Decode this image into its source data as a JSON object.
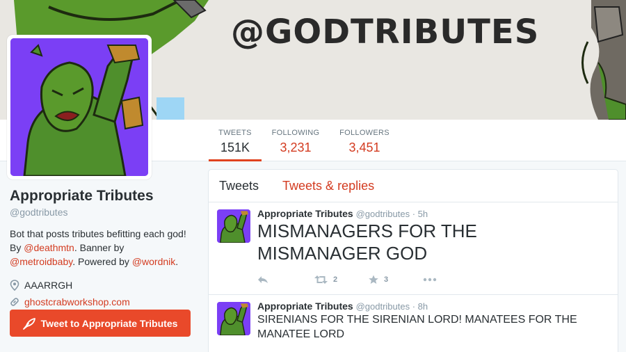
{
  "banner": {
    "handle": "@GODTRIBUTES"
  },
  "nav": {
    "tweets": {
      "label": "TWEETS",
      "value": "151K"
    },
    "following": {
      "label": "FOLLOWING",
      "value": "3,231"
    },
    "followers": {
      "label": "FOLLOWERS",
      "value": "3,451"
    }
  },
  "profile": {
    "name": "Appropriate Tributes",
    "screen_name": "@godtributes",
    "bio_line1": "Bot that posts tributes befitting each god!",
    "bio_by": "By ",
    "bio_by_link": "@deathmtn",
    "bio_banner": ". Banner by",
    "bio_banner_link": "@metroidbaby",
    "bio_powered": ". Powered by ",
    "bio_powered_link": "@wordnik",
    "bio_end": ".",
    "location": "AAARRGH",
    "website": "ghostcrabworkshop.com",
    "tweet_to_button": "Tweet to Appropriate Tributes"
  },
  "timeline": {
    "tabs": {
      "tweets": "Tweets",
      "replies": "Tweets & replies"
    },
    "tweets": [
      {
        "author": "Appropriate Tributes",
        "handle": "@godtributes",
        "sep": " · ",
        "time": "5h",
        "text": "MISMANAGERS FOR THE MISMANAGER GOD",
        "retweets": "2",
        "favorites": "3"
      },
      {
        "author": "Appropriate Tributes",
        "handle": "@godtributes",
        "sep": " · ",
        "time": "8h",
        "text": "SIRENIANS FOR THE SIRENIAN LORD! MANATEES FOR THE MANATEE LORD"
      }
    ]
  },
  "icons": {
    "location": "map-pin-icon",
    "website": "link-icon",
    "tweet_to": "quill-icon",
    "reply": "reply-icon",
    "retweet": "retweet-icon",
    "favorite": "star-icon",
    "more": "more-icon"
  },
  "colors": {
    "accent": "#d33b20",
    "button": "#e9492a",
    "avatar_bg": "#7b3ff5",
    "ogre_green": "#4f8f2c"
  }
}
